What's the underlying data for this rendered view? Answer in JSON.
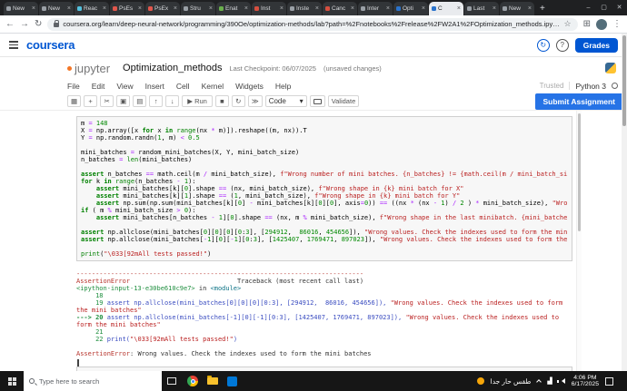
{
  "browser": {
    "tabs": [
      {
        "label": "New",
        "color": "#9aa0a6"
      },
      {
        "label": "New",
        "color": "#9aa0a6"
      },
      {
        "label": "Reac",
        "color": "#53c1de"
      },
      {
        "label": "PsEs",
        "color": "#e2574c"
      },
      {
        "label": "PsEx",
        "color": "#e2574c"
      },
      {
        "label": "Stru",
        "color": "#9aa0a6"
      },
      {
        "label": "Enat",
        "color": "#6ab04c"
      },
      {
        "label": "Inst",
        "color": "#d64f3f"
      },
      {
        "label": "Inste",
        "color": "#9aa0a6"
      },
      {
        "label": "Canc",
        "color": "#d64f3f"
      },
      {
        "label": "Inter",
        "color": "#9aa0a6"
      },
      {
        "label": "Opti",
        "color": "#2a73cc"
      },
      {
        "label": "C",
        "color": "#2a73cc",
        "active": true
      },
      {
        "label": "Last",
        "color": "#9aa0a6"
      },
      {
        "label": "New",
        "color": "#9aa0a6"
      }
    ],
    "new_tab_button": "+",
    "window_controls": {
      "minimize": "–",
      "maximize": "▢",
      "close": "✕"
    },
    "back": "←",
    "forward": "→",
    "reload": "↻",
    "url": "coursera.org/learn/deep-neural-network/programming/390Oe/optimization-methods/lab?path=%2Fnotebooks%2Frelease%2FW2A1%2FOptimization_methods.ipynb",
    "bookmark_star": "☆",
    "extensions_glyph": "⊞",
    "menu_dots": "⋮"
  },
  "coursera": {
    "logo": "coursera",
    "refresh_glyph": "↻",
    "help_glyph": "?",
    "grades_label": "Grades"
  },
  "jupyter": {
    "logo": "jupyter",
    "title": "Optimization_methods",
    "checkpoint": "Last Checkpoint: 06/07/2025",
    "unsaved": "(unsaved changes)",
    "menus": [
      "File",
      "Edit",
      "View",
      "Insert",
      "Cell",
      "Kernel",
      "Widgets",
      "Help"
    ],
    "trusted": "Trusted",
    "kernel_name": "Python 3",
    "toolbar": {
      "icons": [
        {
          "name": "save-icon",
          "glyph": "▦"
        },
        {
          "name": "add-cell-icon",
          "glyph": "+"
        },
        {
          "name": "cut-cell-icon",
          "glyph": "✂"
        },
        {
          "name": "copy-cell-icon",
          "glyph": "▣"
        },
        {
          "name": "paste-cell-icon",
          "glyph": "▤"
        },
        {
          "name": "move-cell-up-icon",
          "glyph": "↑"
        },
        {
          "name": "move-cell-down-icon",
          "glyph": "↓"
        }
      ],
      "run_glyph": "▶",
      "run_label": "Run",
      "icons_after_run": [
        {
          "name": "interrupt-kernel-icon",
          "glyph": "■"
        },
        {
          "name": "restart-kernel-icon",
          "glyph": "↻"
        },
        {
          "name": "restart-run-all-icon",
          "glyph": "≫"
        }
      ],
      "cell_type": "Code",
      "cell_type_caret": "▾",
      "validate_label": "Validate",
      "submit_label": "Submit Assignment"
    }
  },
  "code_cell": {
    "lines": [
      [
        [
          "p",
          "m "
        ],
        [
          "o",
          "="
        ],
        [
          "p",
          " "
        ],
        [
          "n",
          "148"
        ]
      ],
      [
        [
          "p",
          "X "
        ],
        [
          "o",
          "="
        ],
        [
          "p",
          " np.array([x "
        ],
        [
          "k",
          "for"
        ],
        [
          "p",
          " x "
        ],
        [
          "k",
          "in"
        ],
        [
          "p",
          " "
        ],
        [
          "b",
          "range"
        ],
        [
          "p",
          "(nx "
        ],
        [
          "o",
          "*"
        ],
        [
          "p",
          " m)]).reshape((m, nx)).T"
        ]
      ],
      [
        [
          "p",
          "Y "
        ],
        [
          "o",
          "="
        ],
        [
          "p",
          " np.random.randn("
        ],
        [
          "n",
          "1"
        ],
        [
          "p",
          ", m) "
        ],
        [
          "o",
          "<"
        ],
        [
          "p",
          " "
        ],
        [
          "n",
          "0.5"
        ]
      ],
      [],
      [
        [
          "p",
          "mini_batches "
        ],
        [
          "o",
          "="
        ],
        [
          "p",
          " random_mini_batches(X, Y, mini_batch_size)"
        ]
      ],
      [
        [
          "p",
          "n_batches "
        ],
        [
          "o",
          "="
        ],
        [
          "p",
          " "
        ],
        [
          "b",
          "len"
        ],
        [
          "p",
          "(mini_batches)"
        ]
      ],
      [],
      [
        [
          "k",
          "assert"
        ],
        [
          "p",
          " n_batches "
        ],
        [
          "o",
          "=="
        ],
        [
          "p",
          " math.ceil(m "
        ],
        [
          "o",
          "/"
        ],
        [
          "p",
          " mini_batch_size), "
        ],
        [
          "s",
          "f\"Wrong number of mini batches. {n_batches} != {math.ceil(m / mini_batch_size)}\""
        ]
      ],
      [
        [
          "k",
          "for"
        ],
        [
          "p",
          " k "
        ],
        [
          "k",
          "in"
        ],
        [
          "p",
          " "
        ],
        [
          "b",
          "range"
        ],
        [
          "p",
          "(n_batches "
        ],
        [
          "o",
          "-"
        ],
        [
          "p",
          " "
        ],
        [
          "n",
          "1"
        ],
        [
          "p",
          "):"
        ]
      ],
      [
        [
          "p",
          "    "
        ],
        [
          "k",
          "assert"
        ],
        [
          "p",
          " mini_batches[k]["
        ],
        [
          "n",
          "0"
        ],
        [
          "p",
          "].shape "
        ],
        [
          "o",
          "=="
        ],
        [
          "p",
          " (nx, mini_batch_size), "
        ],
        [
          "s",
          "f\"Wrong shape in {k} mini batch for X\""
        ]
      ],
      [
        [
          "p",
          "    "
        ],
        [
          "k",
          "assert"
        ],
        [
          "p",
          " mini_batches[k]["
        ],
        [
          "n",
          "1"
        ],
        [
          "p",
          "].shape "
        ],
        [
          "o",
          "=="
        ],
        [
          "p",
          " ("
        ],
        [
          "n",
          "1"
        ],
        [
          "p",
          ", mini_batch_size), "
        ],
        [
          "s",
          "f\"Wrong shape in {k} mini batch for Y\""
        ]
      ],
      [
        [
          "p",
          "    "
        ],
        [
          "k",
          "assert"
        ],
        [
          "p",
          " np.sum(np.sum(mini_batches[k]["
        ],
        [
          "n",
          "0"
        ],
        [
          "p",
          "] "
        ],
        [
          "o",
          "-"
        ],
        [
          "p",
          " mini_batches[k]["
        ],
        [
          "n",
          "0"
        ],
        [
          "p",
          "]["
        ],
        [
          "n",
          "0"
        ],
        [
          "p",
          "], axis"
        ],
        [
          "o",
          "="
        ],
        [
          "n",
          "0"
        ],
        [
          "p",
          ")) "
        ],
        [
          "o",
          "=="
        ],
        [
          "p",
          " ((nx "
        ],
        [
          "o",
          "*"
        ],
        [
          "p",
          " (nx "
        ],
        [
          "o",
          "-"
        ],
        [
          "p",
          " "
        ],
        [
          "n",
          "1"
        ],
        [
          "p",
          ") "
        ],
        [
          "o",
          "/"
        ],
        [
          "p",
          " "
        ],
        [
          "n",
          "2"
        ],
        [
          "p",
          " ) "
        ],
        [
          "o",
          "*"
        ],
        [
          "p",
          " mini_batch_size), "
        ],
        [
          "s",
          "\"Wrong"
        ]
      ],
      [
        [
          "k",
          "if"
        ],
        [
          "p",
          " ( m "
        ],
        [
          "o",
          "%"
        ],
        [
          "p",
          " mini_batch_size "
        ],
        [
          "o",
          ">"
        ],
        [
          "p",
          " "
        ],
        [
          "n",
          "0"
        ],
        [
          "p",
          "):"
        ]
      ],
      [
        [
          "p",
          "    "
        ],
        [
          "k",
          "assert"
        ],
        [
          "p",
          " mini_batches[n_batches "
        ],
        [
          "o",
          "-"
        ],
        [
          "p",
          " "
        ],
        [
          "n",
          "1"
        ],
        [
          "p",
          "]["
        ],
        [
          "n",
          "0"
        ],
        [
          "p",
          "].shape "
        ],
        [
          "o",
          "=="
        ],
        [
          "p",
          " (nx, m "
        ],
        [
          "o",
          "%"
        ],
        [
          "p",
          " mini_batch_size), "
        ],
        [
          "s",
          "f\"Wrong shape in the last minibatch. {mini_batches"
        ]
      ],
      [],
      [
        [
          "k",
          "assert"
        ],
        [
          "p",
          " np.allclose(mini_batches["
        ],
        [
          "n",
          "0"
        ],
        [
          "p",
          "]["
        ],
        [
          "n",
          "0"
        ],
        [
          "p",
          "]["
        ],
        [
          "n",
          "0"
        ],
        [
          "p",
          "]["
        ],
        [
          "n",
          "0"
        ],
        [
          "p",
          ":"
        ],
        [
          "n",
          "3"
        ],
        [
          "p",
          "], ["
        ],
        [
          "n",
          "294912"
        ],
        [
          "p",
          ",  "
        ],
        [
          "n",
          "86016"
        ],
        [
          "p",
          ", "
        ],
        [
          "n",
          "454656"
        ],
        [
          "p",
          "]), "
        ],
        [
          "s",
          "\"Wrong values. Check the indexes used to form the mini"
        ]
      ],
      [
        [
          "k",
          "assert"
        ],
        [
          "p",
          " np.allclose(mini_batches["
        ],
        [
          "o",
          "-"
        ],
        [
          "n",
          "1"
        ],
        [
          "p",
          "]["
        ],
        [
          "n",
          "0"
        ],
        [
          "p",
          "]["
        ],
        [
          "o",
          "-"
        ],
        [
          "n",
          "1"
        ],
        [
          "p",
          "]["
        ],
        [
          "n",
          "0"
        ],
        [
          "p",
          ":"
        ],
        [
          "n",
          "3"
        ],
        [
          "p",
          "], ["
        ],
        [
          "n",
          "1425407"
        ],
        [
          "p",
          ", "
        ],
        [
          "n",
          "1769471"
        ],
        [
          "p",
          ", "
        ],
        [
          "n",
          "897023"
        ],
        [
          "p",
          "]), "
        ],
        [
          "s",
          "\"Wrong values. Check the indexes used to form the m"
        ]
      ],
      [],
      [
        [
          "b",
          "print"
        ],
        [
          "p",
          "("
        ],
        [
          "s",
          "\"\\033[92mAll tests passed!\""
        ],
        [
          "p",
          ")"
        ]
      ]
    ]
  },
  "output": {
    "lines": [
      [
        [
          "r",
          "---------------------------------------------------------------------------"
        ]
      ],
      [
        [
          "r",
          "AssertionError"
        ],
        [
          "t",
          "                            Traceback (most recent call last)"
        ]
      ],
      [
        [
          "g",
          "<ipython-input-13-e30be610c9e7>"
        ],
        [
          "t",
          " in "
        ],
        [
          "m",
          "<module>"
        ]
      ],
      [
        [
          "g",
          "     18"
        ]
      ],
      [
        [
          "g",
          "     19"
        ],
        [
          "c",
          " assert np.allclose(mini_batches[0][0][0][0:3], [294912,  86016, 454656]), "
        ],
        [
          "s",
          "\"Wrong values. Check the indexes used to form"
        ]
      ],
      [
        [
          "s",
          "the mini batches\""
        ]
      ],
      [
        [
          "gb",
          "---> 20"
        ],
        [
          "c",
          " assert np.allclose(mini_batches[-1][0][-1][0:3], [1425407, 1769471, 897023]), "
        ],
        [
          "s",
          "\"Wrong values. Check the indexes used to"
        ]
      ],
      [
        [
          "s",
          "form the mini batches\""
        ]
      ],
      [
        [
          "g",
          "     21"
        ]
      ],
      [
        [
          "g",
          "     22"
        ],
        [
          "c",
          " print("
        ],
        [
          "s",
          "\"\\033[92mAll tests passed!\""
        ],
        [
          "c",
          ")"
        ]
      ],
      [],
      [
        [
          "r",
          "AssertionError"
        ],
        [
          "t",
          ": Wrong values. Check the indexes used to form the mini batches"
        ]
      ]
    ]
  },
  "taskbar": {
    "search_placeholder": "Type here to search",
    "weather_text": "طقس حار جدا",
    "time": "4:06 PM",
    "date": "6/17/2025"
  }
}
